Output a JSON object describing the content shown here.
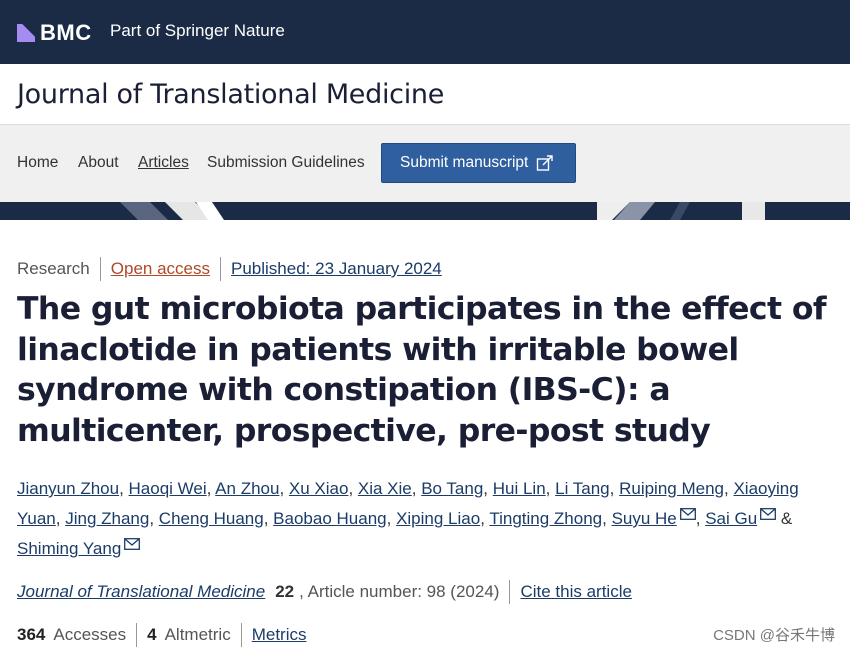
{
  "brand": {
    "logo_text": "BMC",
    "tagline": "Part of Springer Nature"
  },
  "journal": {
    "title": "Journal of Translational Medicine"
  },
  "nav": {
    "items": [
      "Home",
      "About",
      "Articles",
      "Submission Guidelines"
    ],
    "submit_label": "Submit manuscript"
  },
  "article": {
    "type": "Research",
    "access": "Open access",
    "published": "Published: 23 January 2024",
    "title": "The gut microbiota participates in the effect of linaclotide in patients with irritable bowel syndrome with constipation (IBS-C): a multicenter, prospective, pre-post study",
    "authors": [
      "Jianyun Zhou",
      "Haoqi Wei",
      "An Zhou",
      "Xu Xiao",
      "Xia Xie",
      "Bo Tang",
      "Hui Lin",
      "Li Tang",
      "Ruiping Meng",
      "Xiaoying Yuan",
      "Jing Zhang",
      "Cheng Huang",
      "Baobao Huang",
      "Xiping Liao",
      "Tingting Zhong",
      "Suyu He",
      "Sai Gu",
      "Shiming Yang"
    ],
    "citation": {
      "journal": "Journal of Translational Medicine",
      "volume": "22",
      "rest": ", Article number: 98 (2024)",
      "cite_link": "Cite this article"
    },
    "metrics": {
      "accesses_count": "364",
      "accesses_label": "Accesses",
      "altmetric_count": "4",
      "altmetric_label": "Altmetric",
      "metrics_link": "Metrics"
    }
  },
  "watermark": "CSDN @谷禾牛博",
  "colors": {
    "brand_bar": "#1c2b45",
    "link": "#1c3c68",
    "open_access": "#b0482a",
    "submit_button": "#2f5f9f",
    "logo_mark": "#a58cf0"
  },
  "icons": [
    "bmc-logo-icon",
    "submit-external-icon",
    "mail-icon"
  ]
}
